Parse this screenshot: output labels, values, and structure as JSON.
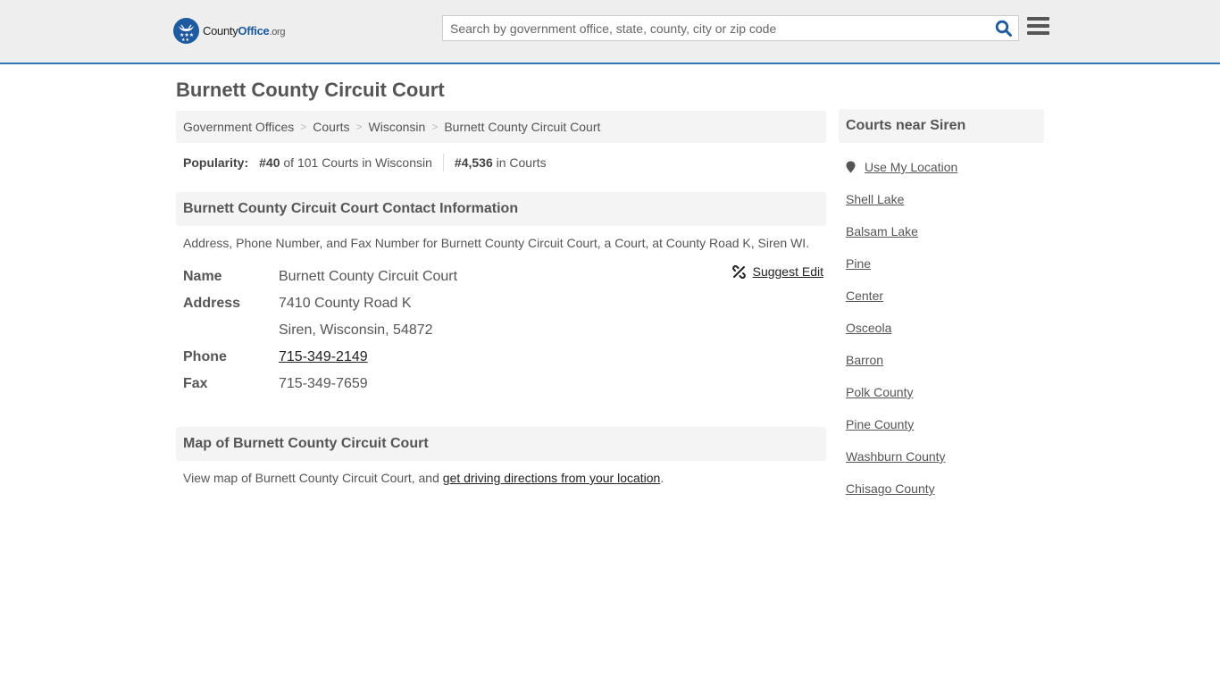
{
  "header": {
    "logo_text_county": "County",
    "logo_text_office": "Office",
    "logo_text_org": ".org",
    "search_placeholder": "Search by government office, state, county, city or zip code",
    "search_value": "",
    "search_icon": "search-icon",
    "menu_icon": "hamburger-menu-icon",
    "accent_color": "#2f76b3"
  },
  "page": {
    "title": "Burnett County Circuit Court"
  },
  "breadcrumb": [
    {
      "label": "Government Offices"
    },
    {
      "label": "Courts"
    },
    {
      "label": "Wisconsin"
    },
    {
      "label": "Burnett County Circuit Court"
    }
  ],
  "popularity": {
    "label": "Popularity:",
    "state_rank": "#40",
    "state_rank_text": "of 101 Courts in Wisconsin",
    "national_rank": "#4,536",
    "national_rank_text": "in Courts"
  },
  "contact": {
    "heading": "Burnett County Circuit Court Contact Information",
    "description": "Address, Phone Number, and Fax Number for Burnett County Circuit Court, a Court, at County Road K, Siren WI.",
    "suggest_edit": "Suggest Edit",
    "rows": [
      {
        "label": "Name",
        "value": "Burnett County Circuit Court"
      },
      {
        "label": "Address",
        "value": "7410 County Road K"
      },
      {
        "label": "",
        "value": "Siren, Wisconsin, 54872"
      },
      {
        "label": "Phone",
        "value": "715-349-2149"
      },
      {
        "label": "Fax",
        "value": "715-349-7659"
      }
    ]
  },
  "map": {
    "heading": "Map of Burnett County Circuit Court",
    "text_before": "View map of Burnett County Circuit Court, and ",
    "link_text": "get driving directions from your location",
    "text_after": "."
  },
  "sidebar": {
    "heading": "Courts near Siren",
    "use_location": "Use My Location",
    "items": [
      {
        "label": "Shell Lake"
      },
      {
        "label": "Balsam Lake"
      },
      {
        "label": "Pine"
      },
      {
        "label": "Center"
      },
      {
        "label": "Osceola"
      },
      {
        "label": "Barron"
      },
      {
        "label": "Polk County"
      },
      {
        "label": "Pine County"
      },
      {
        "label": "Washburn County"
      },
      {
        "label": "Chisago County"
      }
    ]
  }
}
